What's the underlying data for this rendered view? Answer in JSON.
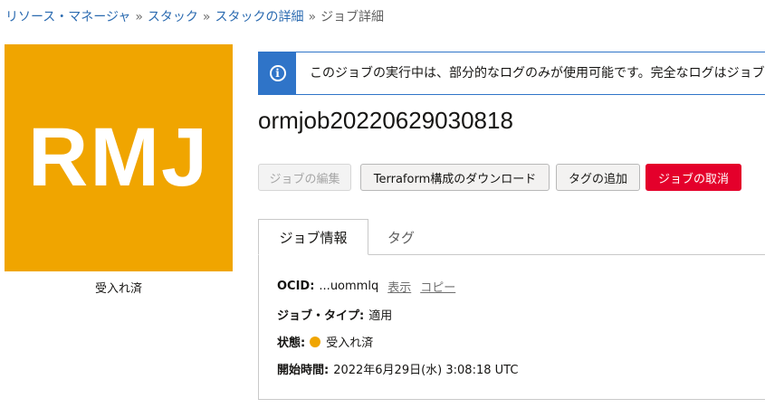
{
  "breadcrumb": {
    "items": [
      "リソース・マネージャ",
      "スタック",
      "スタックの詳細"
    ],
    "separator": "»",
    "current": "ジョブ詳細"
  },
  "avatar": {
    "initials": "RMJ",
    "color": "#f0a500",
    "status": "受入れ済"
  },
  "banner": {
    "icon": "info-icon",
    "message": "このジョブの実行中は、部分的なログのみが使用可能です。完全なログはジョブ"
  },
  "job": {
    "title": "ormjob20220629030818"
  },
  "toolbar": {
    "edit_label": "ジョブの編集",
    "download_label": "Terraform構成のダウンロード",
    "add_tag_label": "タグの追加",
    "cancel_label": "ジョブの取消"
  },
  "tabs": {
    "info": "ジョブ情報",
    "tags": "タグ"
  },
  "details": {
    "ocid_label": "OCID:",
    "ocid_value": "...uommlq",
    "show_label": "表示",
    "copy_label": "コピー",
    "type_label": "ジョブ・タイプ:",
    "type_value": "適用",
    "status_label": "状態:",
    "status_value": "受入れ済",
    "status_color": "#f0a500",
    "start_label": "開始時間:",
    "start_value": "2022年6月29日(水) 3:08:18 UTC"
  }
}
